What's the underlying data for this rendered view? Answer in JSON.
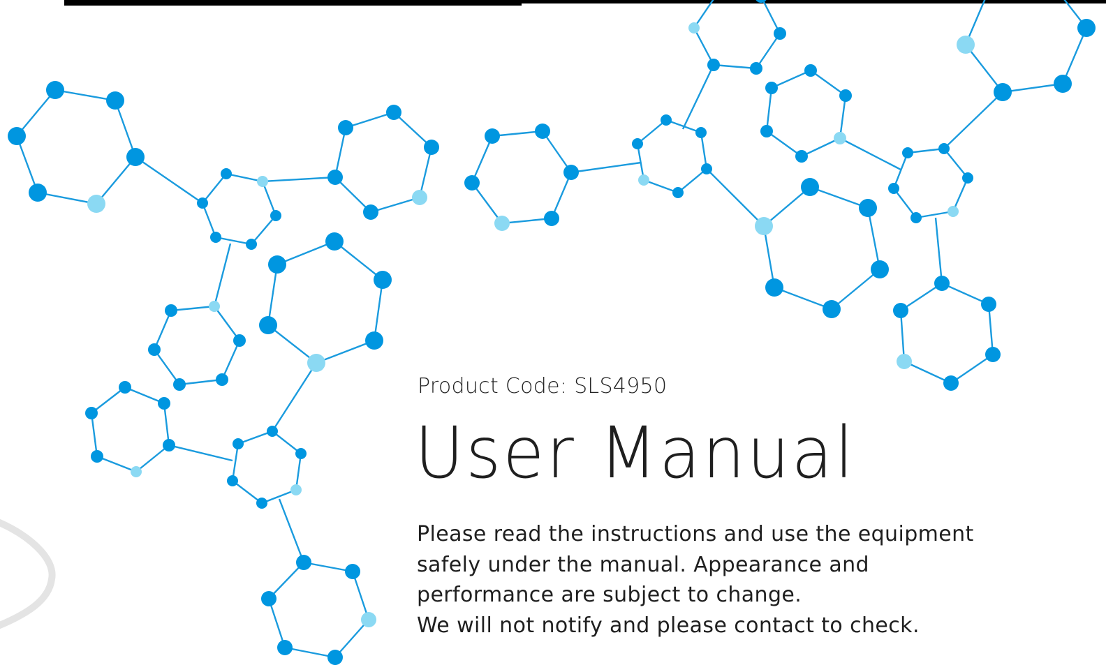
{
  "document": {
    "product_code": "Product Code: SLS4950",
    "title": "User Manual",
    "notice_lines": [
      "Please read the instructions and use the equipment",
      "safely under the manual. Appearance and",
      "performance are subject to change.",
      "We will not notify and please contact to check."
    ]
  },
  "colors": {
    "node_dark": "#0096e0",
    "node_light": "#8bd9f3",
    "bond": "#1a9bde",
    "background": "#ffffff",
    "text": "#1f1f1f",
    "top_bar": "#000000"
  },
  "decoration": {
    "art": "molecule-network",
    "icon": "hexagon-icon"
  }
}
